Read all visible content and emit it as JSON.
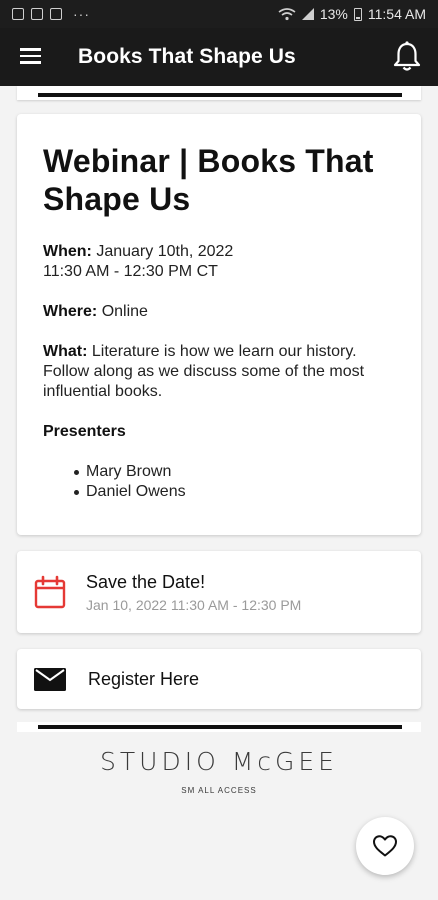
{
  "status_bar": {
    "battery_text": "13%",
    "time": "11:54 AM",
    "dots": "···"
  },
  "app_bar": {
    "title": "Books That Shape Us"
  },
  "event": {
    "title": "Webinar | Books That Shape Us",
    "when_label": "When:",
    "when_date": "January 10th, 2022",
    "when_time": "11:30 AM - 12:30 PM CT",
    "where_label": "Where:",
    "where_value": "Online",
    "what_label": "What:",
    "what_value": "Literature is how we learn our history. Follow along as we discuss some of the most influential books.",
    "presenters_heading": "Presenters",
    "presenters": [
      "Mary Brown",
      "Daniel Owens"
    ]
  },
  "save_date": {
    "title": "Save the Date!",
    "subtitle": "Jan 10, 2022 11:30 AM - 12:30 PM",
    "icon": "calendar-icon",
    "icon_color": "#e53935"
  },
  "register": {
    "label": "Register Here",
    "icon": "mail-icon"
  },
  "branding": {
    "logo_text": "STUDIO McGEE",
    "logo_subtext": "SM ALL ACCESS"
  },
  "fab": {
    "icon": "heart-icon"
  }
}
